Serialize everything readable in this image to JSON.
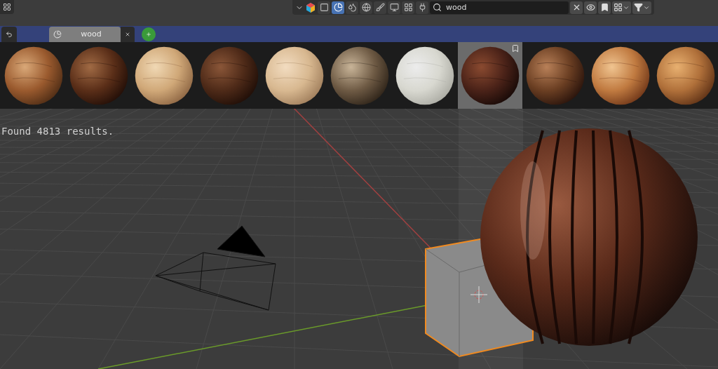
{
  "toolbar": {
    "modes": [
      {
        "selected": false
      },
      {
        "selected": true
      },
      {
        "selected": false
      },
      {
        "selected": false
      },
      {
        "selected": false
      },
      {
        "selected": false
      },
      {
        "selected": false
      },
      {
        "selected": false
      }
    ],
    "search": {
      "value": "wood"
    }
  },
  "tabs": [
    {
      "label": "wood",
      "selected": true
    }
  ],
  "thumbnails": [
    {
      "selected": false
    },
    {
      "selected": false
    },
    {
      "selected": false
    },
    {
      "selected": false
    },
    {
      "selected": false
    },
    {
      "selected": false
    },
    {
      "selected": false
    },
    {
      "selected": true
    },
    {
      "selected": false
    },
    {
      "selected": false
    },
    {
      "selected": false
    }
  ],
  "status": "Found 4813 results."
}
